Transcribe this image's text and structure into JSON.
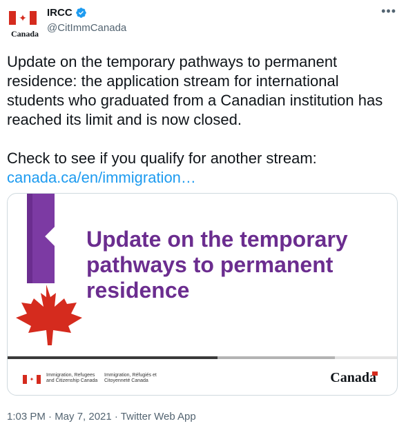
{
  "account": {
    "avatar_wordmark": "Canada",
    "name": "IRCC",
    "handle": "@CitImmCanada",
    "more_label": "•••"
  },
  "tweet": {
    "paragraph1": "Update on the temporary pathways to permanent residence: the application stream for international students who graduated from a Canadian institution has reached its limit and is now closed.",
    "paragraph2": "Check to see if you qualify for another stream:",
    "link": "canada.ca/en/immigration…"
  },
  "card": {
    "title": "Update on the temporary pathways to permanent residence",
    "dept_en": "Immigration, Refugees and Citizenship Canada",
    "dept_fr": "Immigration, Réfugiés et Citoyenneté Canada",
    "wordmark": "Canada"
  },
  "meta": {
    "timestamp": "1:03 PM · May 7, 2021 · Twitter Web App"
  },
  "colors": {
    "accent": "#1d9bf0",
    "card_title": "#6b2d8f",
    "maple_red": "#d52b1e"
  }
}
